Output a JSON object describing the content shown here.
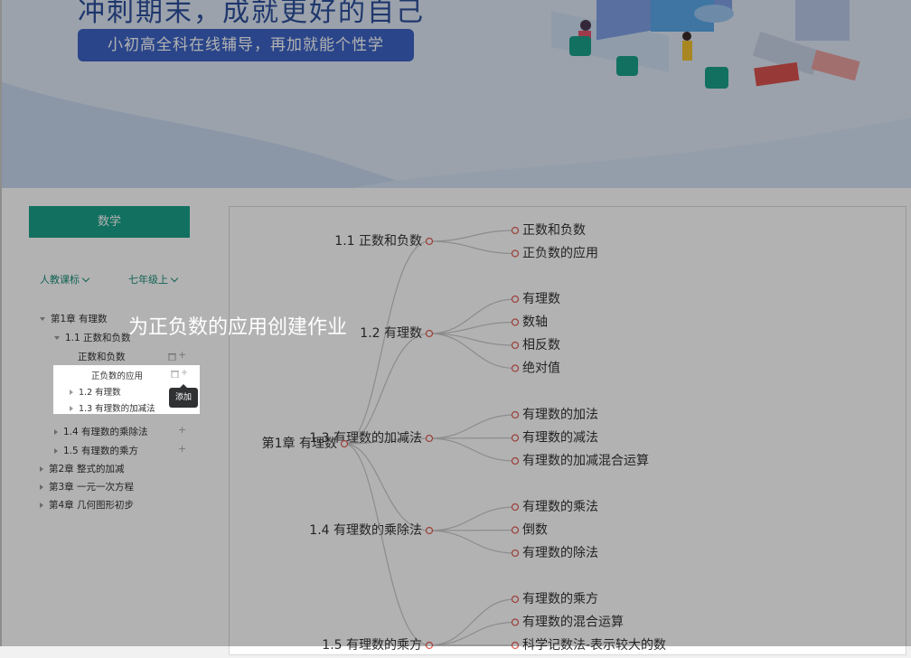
{
  "banner": {
    "slogan": "冲刺期末，成就更好的自己",
    "subtitle": "小初高全科在线辅导，再加就能个性学"
  },
  "sidebar": {
    "subject": "数学",
    "textbook": "人教课标",
    "grade": "七年级上",
    "tree": {
      "ch1": "第1章 有理数",
      "s11": "1.1 正数和负数",
      "s11a": "正数和负数",
      "s11b": "正负数的应用",
      "s12": "1.2 有理数",
      "s13": "1.3 有理数的加减法",
      "s14": "1.4 有理数的乘除法",
      "s15": "1.5 有理数的乘方",
      "ch2": "第2章 整式的加减",
      "ch3": "第3章 一元一次方程",
      "ch4": "第4章 几何图形初步"
    }
  },
  "tooltip": "添加",
  "guide_text": "为正负数的应用创建作业",
  "mindmap": {
    "root": "第1章 有理数",
    "branches": [
      {
        "label": "1.1 正数和负数",
        "children": [
          "正数和负数",
          "正负数的应用"
        ]
      },
      {
        "label": "1.2 有理数",
        "children": [
          "有理数",
          "数轴",
          "相反数",
          "绝对值"
        ]
      },
      {
        "label": "1.3 有理数的加减法",
        "children": [
          "有理数的加法",
          "有理数的减法",
          "有理数的加减混合运算"
        ]
      },
      {
        "label": "1.4 有理数的乘除法",
        "children": [
          "有理数的乘法",
          "倒数",
          "有理数的除法"
        ]
      },
      {
        "label": "1.5 有理数的乘方",
        "children": [
          "有理数的乘方",
          "有理数的混合运算",
          "科学记数法-表示较大的数"
        ]
      }
    ]
  },
  "colors": {
    "accent": "#1aa18a",
    "node_ring": "#e0615a",
    "link": "#c9c9c9",
    "banner_bg": "#dfe9f6",
    "pill": "#3d63c5"
  }
}
